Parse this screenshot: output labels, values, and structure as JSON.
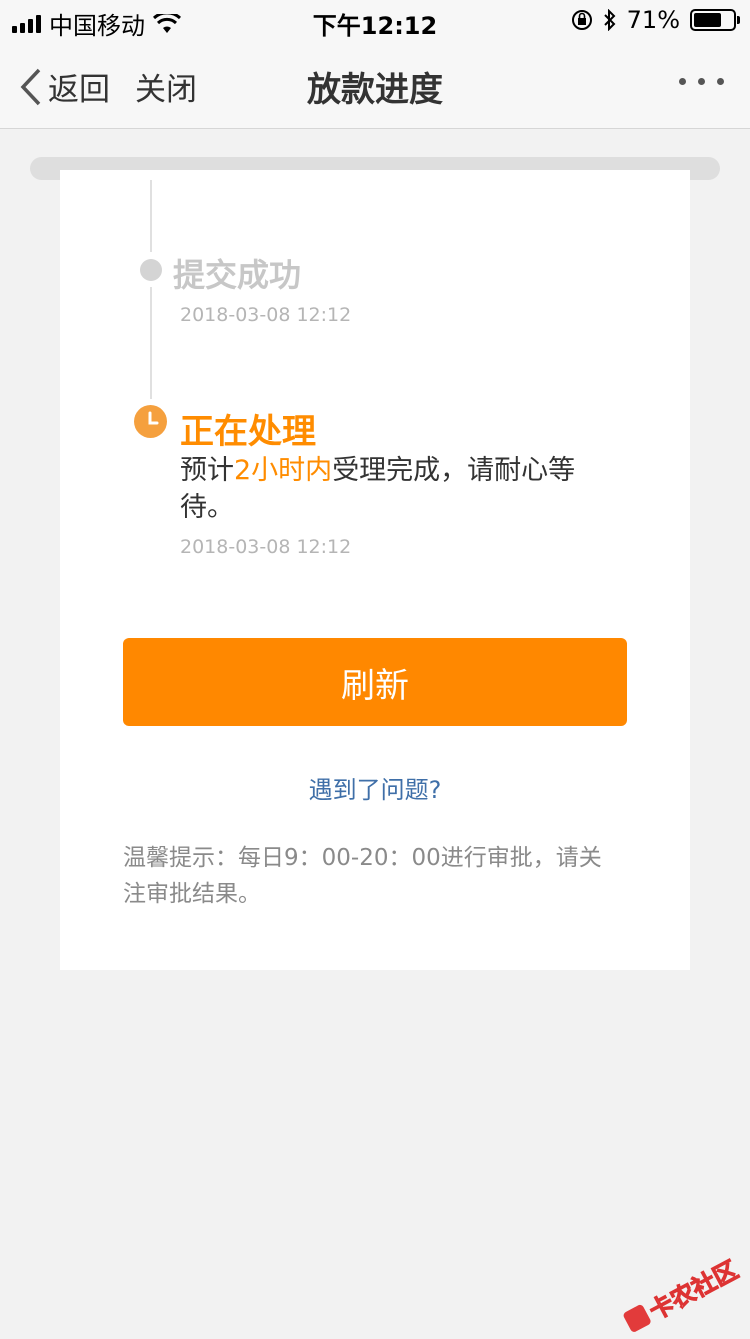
{
  "status_bar": {
    "carrier": "中国移动",
    "time": "下午12:12",
    "battery": "71%",
    "battery_level": 0.71
  },
  "nav": {
    "back_label": "返回",
    "close_label": "关闭",
    "title": "放款进度"
  },
  "timeline": {
    "step1": {
      "title": "提交成功",
      "time": "2018-03-08 12:12"
    },
    "step2": {
      "title": "正在处理",
      "desc_prefix": "预计",
      "desc_highlight": "2小时内",
      "desc_suffix": "受理完成，请耐心等待。",
      "time": "2018-03-08 12:12"
    }
  },
  "actions": {
    "refresh_label": "刷新",
    "problem_link": "遇到了问题?"
  },
  "tips": "温馨提示：每日9：00-20：00进行审批，请关注审批结果。",
  "watermark": "卡农社区",
  "colors": {
    "accent": "#ff8800",
    "link": "#3f6fa8"
  }
}
